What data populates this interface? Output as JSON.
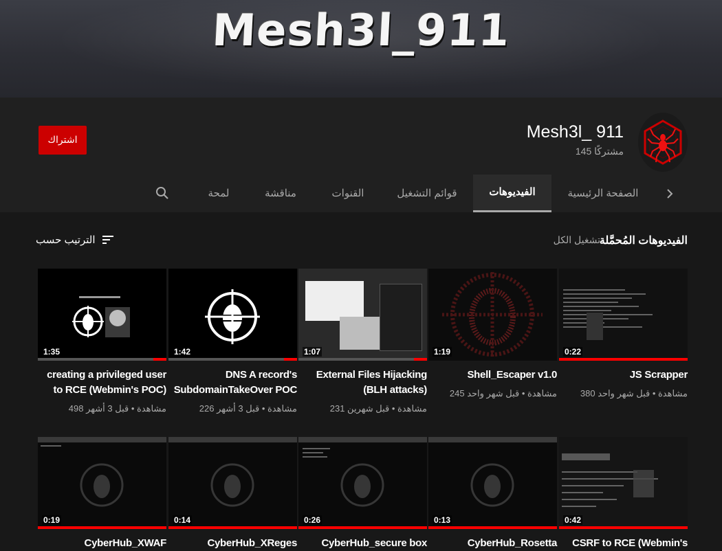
{
  "banner": {
    "text": "Mesh3l_911"
  },
  "channel": {
    "name": "Mesh3l_ 911",
    "subscribers": "145 مشتركًا",
    "subscribe_label": "اشتراك"
  },
  "tabs": [
    {
      "label": "الصفحة الرئيسية"
    },
    {
      "label": "الفيديوهات",
      "active": true
    },
    {
      "label": "قوائم التشغيل"
    },
    {
      "label": "القنوات"
    },
    {
      "label": "مناقشة"
    },
    {
      "label": "لمحة"
    }
  ],
  "section": {
    "title": "الفيديوهات المُحمَّلة",
    "play_all": "تشغيل الكل",
    "sort_label": "الترتيب حسب"
  },
  "videos_row1": [
    {
      "title": "JS Scrapper",
      "duration": "0:22",
      "meta": "380 مشاهدة • قبل شهر واحد",
      "progress": 1.0
    },
    {
      "title": "Shell_Escaper v1.0",
      "duration": "1:19",
      "meta": "245 مشاهدة • قبل شهر واحد",
      "progress": 0.0
    },
    {
      "title": "External Files Hijacking (BLH attacks)",
      "duration": "1:07",
      "meta": "231 مشاهدة • قبل شهرين",
      "progress": 0.1
    },
    {
      "title": "DNS A record's SubdomainTakeOver POC",
      "duration": "1:42",
      "meta": "226 مشاهدة • قبل 3 أشهر",
      "progress": 0.1
    },
    {
      "title": "creating a privileged user to RCE (Webmin's POC)",
      "duration": "1:35",
      "meta": "498 مشاهدة • قبل 3 أشهر",
      "progress": 0.1
    }
  ],
  "videos_row2": [
    {
      "title": "CSRF to RCE (Webmin's",
      "duration": "0:42",
      "progress": 1.0
    },
    {
      "title": "CyberHub_Rosetta",
      "duration": "0:13",
      "progress": 1.0
    },
    {
      "title": "CyberHub_secure box",
      "duration": "0:26",
      "progress": 1.0
    },
    {
      "title": "CyberHub_XReges",
      "duration": "0:14",
      "progress": 1.0
    },
    {
      "title": "CyberHub_XWAF",
      "duration": "0:19",
      "progress": 1.0
    }
  ],
  "colors": {
    "accent": "#cc0000",
    "progress": "#ff0000",
    "background": "#181818",
    "header": "#202020"
  },
  "icons": [
    "spider-avatar-icon",
    "chevron-right-icon",
    "search-icon",
    "sort-icon",
    "bug-logo-icon"
  ]
}
